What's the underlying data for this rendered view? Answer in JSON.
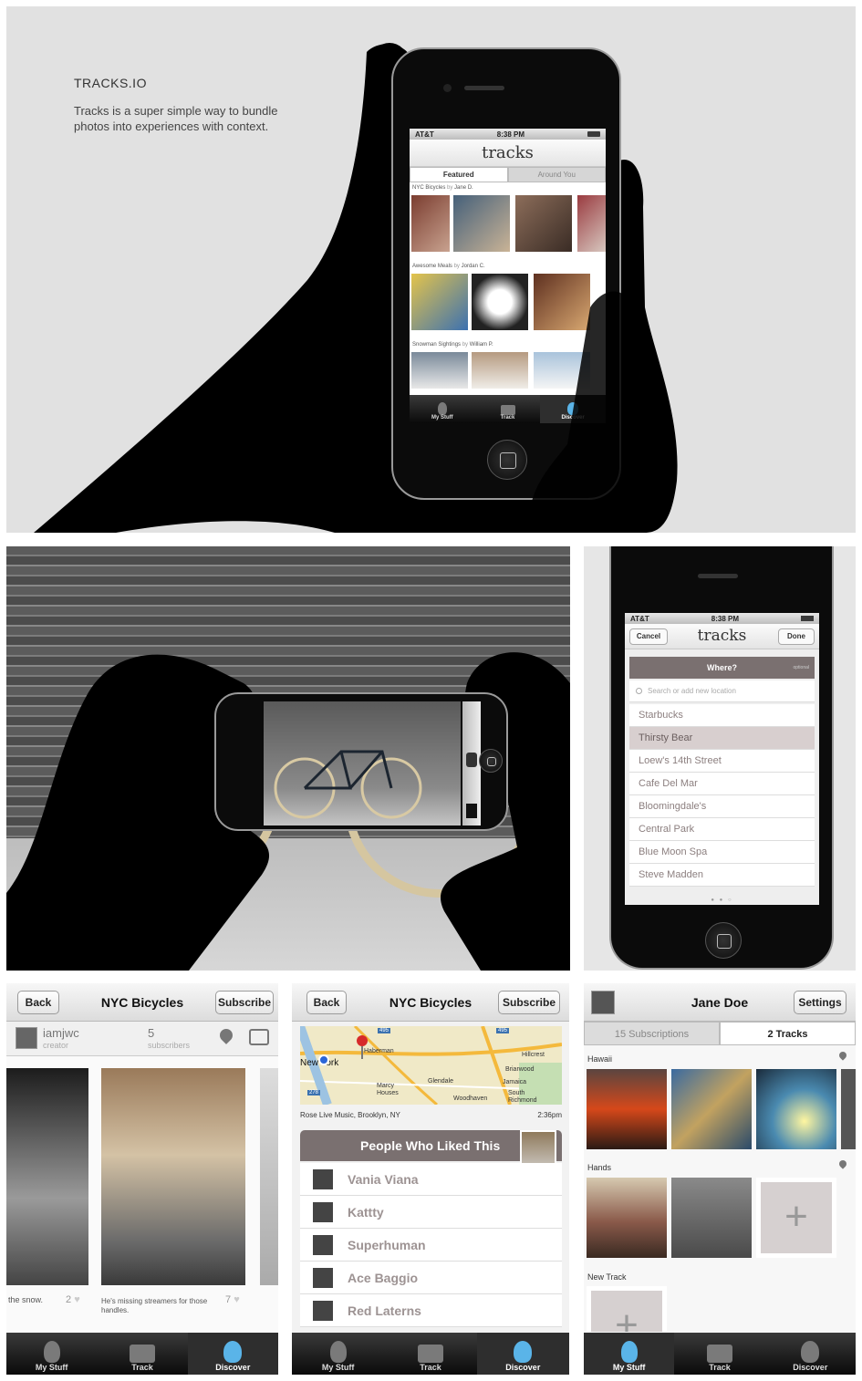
{
  "hero": {
    "brand": "TRACKS.IO",
    "tagline": "Tracks is a super simple way to bundle photos into experiences with context.",
    "phone": {
      "carrier": "AT&T",
      "time": "8:38 PM",
      "app_title": "tracks",
      "tabs": [
        "Featured",
        "Around You"
      ],
      "rows": [
        {
          "title": "NYC Bicycles",
          "by": "by",
          "author": "Jane D."
        },
        {
          "title": "Awesome Meals",
          "by": "by",
          "author": "Jordan C."
        },
        {
          "title": "Snowman Sightings",
          "by": "by",
          "author": "William P."
        }
      ],
      "tabbar": [
        "My Stuff",
        "Track",
        "Discover"
      ]
    }
  },
  "location": {
    "carrier": "AT&T",
    "time": "8:38 PM",
    "cancel": "Cancel",
    "title": "tracks",
    "done": "Done",
    "where": "Where?",
    "optional": "optional",
    "search_placeholder": "Search or add new location",
    "places": [
      "Starbucks",
      "Thirsty Bear",
      "Loew's 14th Street",
      "Cafe Del Mar",
      "Bloomingdale's",
      "Central Park",
      "Blue Moon Spa",
      "Steve Madden"
    ],
    "selected_index": 1
  },
  "track_view": {
    "back": "Back",
    "title": "NYC Bicycles",
    "subscribe": "Subscribe",
    "username": "iamjwc",
    "role": "creator",
    "subscriber_count": "5",
    "subscriber_label": "subscribers",
    "captions": [
      {
        "text": "the snow.",
        "likes": "2"
      },
      {
        "text": "He's missing streamers for those handles.",
        "likes": "7"
      }
    ],
    "tabbar": [
      "My Stuff",
      "Track",
      "Discover"
    ]
  },
  "likes_view": {
    "back": "Back",
    "title": "NYC Bicycles",
    "subscribe": "Subscribe",
    "map_labels": [
      "Haberman",
      "New York",
      "Hillcrest",
      "Glendale",
      "Marcy Houses",
      "Woodhaven",
      "Jamaica",
      "South Richmond Hill",
      "Briarwood",
      "495",
      "495",
      "278"
    ],
    "location": "Rose Live Music, Brooklyn, NY",
    "time": "2:36pm",
    "header": "People Who Liked This",
    "people": [
      "Vania Viana",
      "Kattty",
      "Superhuman",
      "Ace Baggio",
      "Red Laterns"
    ],
    "tabbar": [
      "My Stuff",
      "Track",
      "Discover"
    ]
  },
  "profile_view": {
    "name": "Jane Doe",
    "settings": "Settings",
    "tabs": [
      "15 Subscriptions",
      "2 Tracks"
    ],
    "sections": [
      "Hawaii",
      "Hands",
      "New Track"
    ],
    "add_symbol": "+",
    "tabbar": [
      "My Stuff",
      "Track",
      "Discover"
    ]
  },
  "colors": {
    "active_tab_icon": "#5ab4e8",
    "selected_row": "#d8cfcf",
    "liked_header": "#7a7070"
  }
}
